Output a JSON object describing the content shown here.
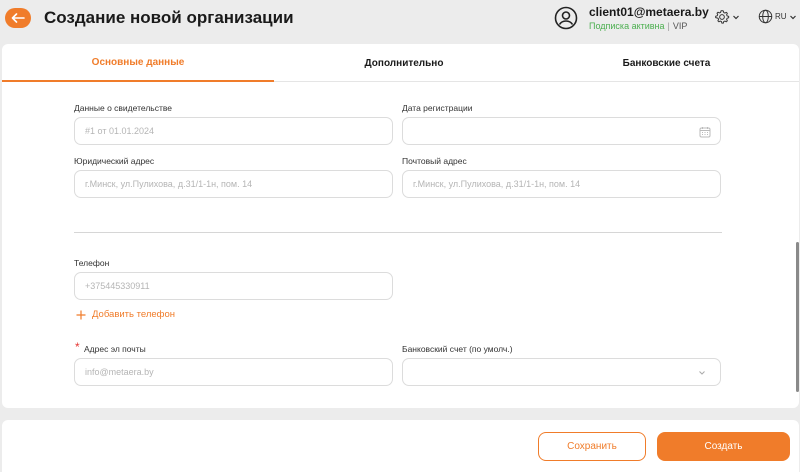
{
  "header": {
    "title": "Создание новой организации",
    "user": {
      "email": "client01@metaera.by",
      "status": "Подписка активна",
      "separator": "|",
      "plan": "VIP"
    },
    "language": "RU"
  },
  "tabs": [
    {
      "label": "Основные данные",
      "active": true
    },
    {
      "label": "Дополнительно",
      "active": false
    },
    {
      "label": "Банковские счета",
      "active": false
    }
  ],
  "form": {
    "certificate": {
      "label": "Данные о свидетельстве",
      "placeholder": "#1 от 01.01.2024"
    },
    "reg_date": {
      "label": "Дата регистрации",
      "placeholder": ""
    },
    "legal_address": {
      "label": "Юридический адрес",
      "placeholder": "г.Минск, ул.Пулихова, д.31/1-1н, пом. 14"
    },
    "postal_address": {
      "label": "Почтовый адрес",
      "placeholder": "г.Минск, ул.Пулихова, д.31/1-1н, пом. 14"
    },
    "phone": {
      "label": "Телефон",
      "placeholder": "+375445330911"
    },
    "add_phone": "Добавить телефон",
    "email": {
      "label": "Адрес эл почты",
      "placeholder": "info@metaera.by",
      "required_mark": "*"
    },
    "bank_account": {
      "label": "Банковский счет (по умолч.)",
      "value": ""
    }
  },
  "footer": {
    "save_label": "Сохранить",
    "create_label": "Создать"
  },
  "colors": {
    "accent": "#f07c2a",
    "status_green": "#4caf50"
  }
}
